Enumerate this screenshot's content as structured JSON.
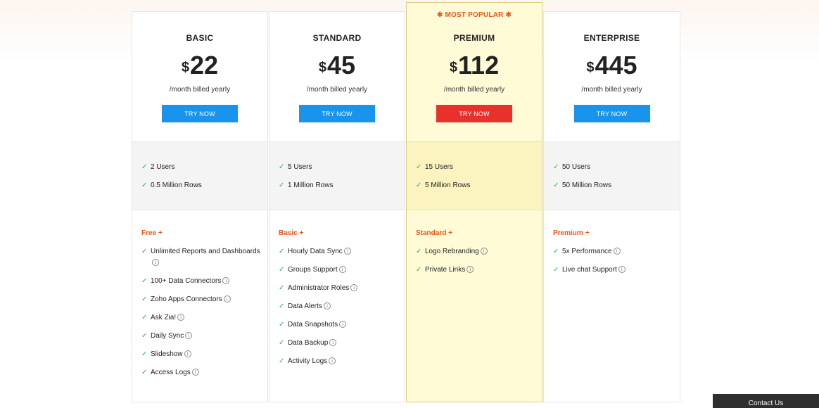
{
  "plans": [
    {
      "name": "BASIC",
      "currency": "$",
      "price": "22",
      "billing": "/month billed yearly",
      "cta": "TRY NOW",
      "limits": [
        "2 Users",
        "0.5 Million Rows"
      ],
      "tier_label": "Free +",
      "features": [
        {
          "label": "Unlimited Reports and Dashboards",
          "info": true
        },
        {
          "label": "100+ Data Connectors",
          "info": true
        },
        {
          "label": "Zoho Apps Connectors",
          "info": true
        },
        {
          "label": "Ask Zia!",
          "info": true
        },
        {
          "label": "Daily Sync",
          "info": true
        },
        {
          "label": "Slideshow",
          "info": true
        },
        {
          "label": "Access Logs",
          "info": true
        }
      ]
    },
    {
      "name": "STANDARD",
      "currency": "$",
      "price": "45",
      "billing": "/month billed yearly",
      "cta": "TRY NOW",
      "limits": [
        "5 Users",
        "1 Million Rows"
      ],
      "tier_label": "Basic +",
      "features": [
        {
          "label": "Hourly Data Sync",
          "info": true
        },
        {
          "label": "Groups Support",
          "info": true
        },
        {
          "label": "Administrator Roles",
          "info": true
        },
        {
          "label": "Data Alerts",
          "info": true
        },
        {
          "label": "Data Snapshots",
          "info": true
        },
        {
          "label": "Data Backup",
          "info": true
        },
        {
          "label": "Activity Logs",
          "info": true
        }
      ]
    },
    {
      "name": "PREMIUM",
      "currency": "$",
      "price": "112",
      "billing": "/month billed yearly",
      "cta": "TRY NOW",
      "badge": "✱ MOST POPULAR ✱",
      "limits": [
        "15 Users",
        "5 Million Rows"
      ],
      "tier_label": "Standard +",
      "features": [
        {
          "label": "Logo Rebranding",
          "info": true
        },
        {
          "label": "Private Links",
          "info": true
        }
      ]
    },
    {
      "name": "ENTERPRISE",
      "currency": "$",
      "price": "445",
      "billing": "/month billed yearly",
      "cta": "TRY NOW",
      "limits": [
        "50 Users",
        "50 Million Rows"
      ],
      "tier_label": "Premium +",
      "features": [
        {
          "label": "5x Performance",
          "info": true
        },
        {
          "label": "Live chat Support",
          "info": true
        }
      ]
    }
  ],
  "contact": "Contact Us",
  "icons": {
    "check": "check-icon",
    "info": "info-icon"
  },
  "colors": {
    "accent_blue": "#1a93ec",
    "accent_red": "#e8302d",
    "tier_orange": "#e8581a",
    "check_green": "#2fae5a",
    "featured_bg": "#fefbd6"
  }
}
